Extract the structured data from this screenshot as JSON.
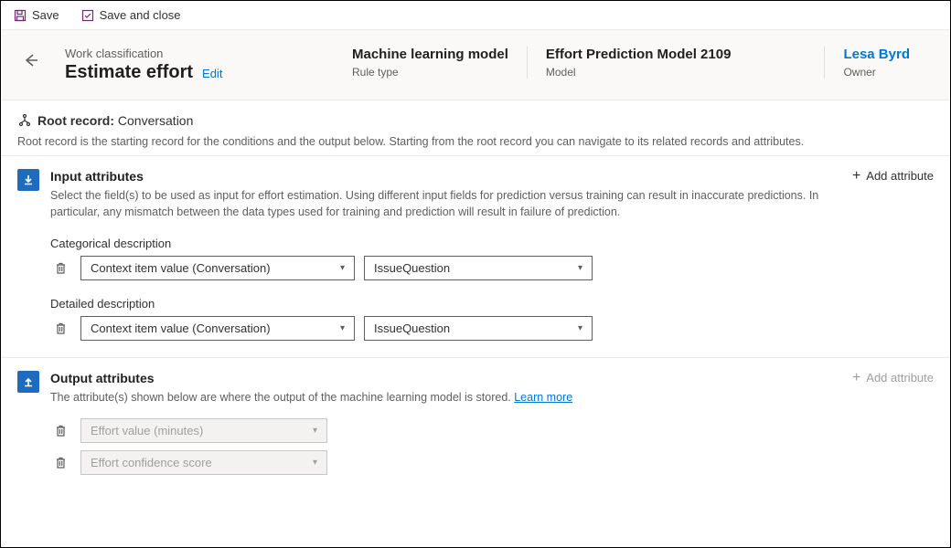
{
  "toolbar": {
    "save": "Save",
    "save_close": "Save and close"
  },
  "header": {
    "breadcrumb": "Work classification",
    "title": "Estimate effort",
    "edit": "Edit",
    "rule_type_value": "Machine learning model",
    "rule_type_label": "Rule type",
    "model_value": "Effort Prediction Model 2109",
    "model_label": "Model",
    "owner_name": "Lesa Byrd",
    "owner_label": "Owner"
  },
  "root": {
    "prefix": "Root record:",
    "value": "Conversation",
    "desc": "Root record is the starting record for the conditions and the output below. Starting from the root record you can navigate to its related records and attributes."
  },
  "input": {
    "title": "Input attributes",
    "desc": "Select the field(s) to be used as input for effort estimation. Using different input fields for prediction versus training can result in inaccurate predictions. In particular, any mismatch between the data types used for training and prediction will result in failure of prediction.",
    "add": "Add attribute",
    "fields": [
      {
        "label": "Categorical description",
        "source": "Context item value (Conversation)",
        "attr": "IssueQuestion"
      },
      {
        "label": "Detailed description",
        "source": "Context item value (Conversation)",
        "attr": "IssueQuestion"
      }
    ]
  },
  "output": {
    "title": "Output attributes",
    "desc_prefix": "The attribute(s) shown below are where the output of the machine learning model is stored.  ",
    "learn": "Learn more",
    "add": "Add attribute",
    "fields": [
      "Effort value (minutes)",
      "Effort confidence score"
    ]
  }
}
